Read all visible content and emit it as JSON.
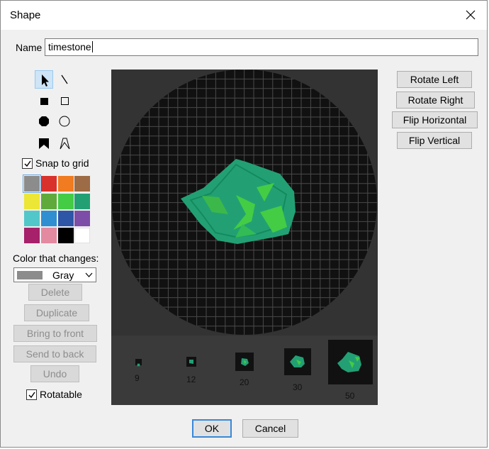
{
  "window": {
    "title": "Shape"
  },
  "name_field": {
    "label": "Name",
    "value": "timestone"
  },
  "tools": [
    {
      "icon": "pointer-icon"
    },
    {
      "icon": "line-icon"
    },
    {
      "icon": "filled-square-icon"
    },
    {
      "icon": "outline-square-icon"
    },
    {
      "icon": "filled-circle-icon"
    },
    {
      "icon": "outline-circle-icon"
    },
    {
      "icon": "filled-polygon-icon"
    },
    {
      "icon": "outline-polygon-icon"
    }
  ],
  "snap_to_grid": {
    "label": "Snap to grid",
    "checked": true
  },
  "palette": [
    "#8c8c8c",
    "#d9322c",
    "#f07b20",
    "#9d6b45",
    "#ece636",
    "#5faa3b",
    "#44cc44",
    "#22a074",
    "#52c7c9",
    "#2f8fd0",
    "#2e56a6",
    "#7d4ea8",
    "#a6206a",
    "#e38aa0",
    "#000000",
    "#ffffff"
  ],
  "color_changes": {
    "label": "Color that changes:",
    "value": "Gray",
    "swatch": "#8c8c8c"
  },
  "buttons": {
    "delete": "Delete",
    "duplicate": "Duplicate",
    "bring_to_front": "Bring to front",
    "send_to_back": "Send to back",
    "undo": "Undo"
  },
  "rotatable": {
    "label": "Rotatable",
    "checked": true
  },
  "transform": {
    "rotate_left": "Rotate Left",
    "rotate_right": "Rotate Right",
    "flip_horizontal": "Flip Horizontal",
    "flip_vertical": "Flip Vertical"
  },
  "preview_sizes": [
    "9",
    "12",
    "20",
    "30",
    "50"
  ],
  "dialog_buttons": {
    "ok": "OK",
    "cancel": "Cancel"
  },
  "colors": {
    "shape_main": "#22a074",
    "shape_accent": "#44cc44",
    "grid_line": "#4a4a4a",
    "editor_bg": "#111111"
  }
}
